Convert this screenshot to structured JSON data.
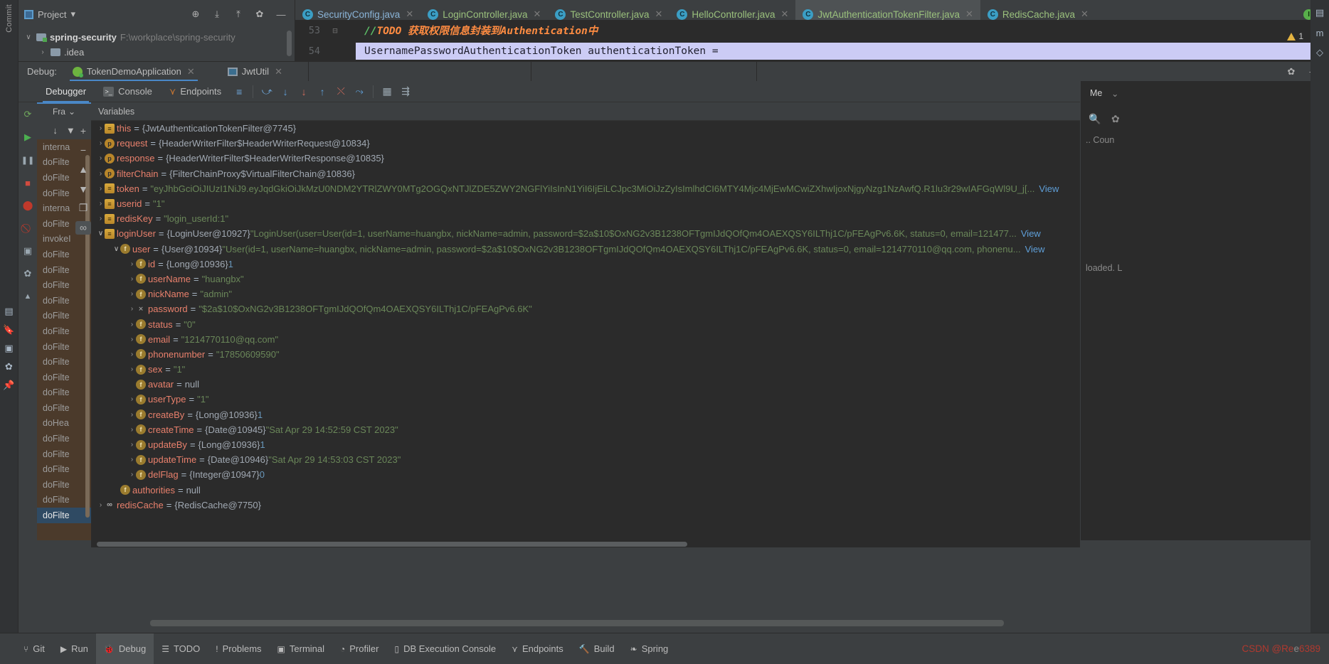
{
  "window": {
    "left_rail_label": "Commit",
    "left_rail_icons": [
      "git-icon",
      "structure-icon",
      "bookmarks-icon",
      "notifications-icon",
      "camera-icon",
      "settings-icon",
      "pin-icon"
    ]
  },
  "project_toolbar": {
    "title": "Project",
    "dropdown_caret": "▾",
    "icons": [
      {
        "name": "locate-icon",
        "glyph": "⊕"
      },
      {
        "name": "expand-all-icon",
        "glyph": "⤓"
      },
      {
        "name": "collapse-all-icon",
        "glyph": "⤒"
      },
      {
        "name": "gear-icon",
        "glyph": "✿"
      },
      {
        "name": "hide-icon",
        "glyph": "—"
      }
    ]
  },
  "project_tree": [
    {
      "twisty": "∨",
      "name": "spring-security",
      "path": "F:\\workplace\\spring-security",
      "bold": true,
      "modified": true
    },
    {
      "twisty": "›",
      "name": ".idea",
      "path": "",
      "bold": false,
      "modified": false
    }
  ],
  "editor_tabs": [
    {
      "label": "SecurityConfig.java",
      "icon": "class-icon",
      "active": false,
      "color": "#8ab4d8"
    },
    {
      "label": "LoginController.java",
      "icon": "class-icon",
      "active": false,
      "color": "#9ac07c"
    },
    {
      "label": "TestController.java",
      "icon": "class-icon",
      "active": false,
      "color": "#9ac07c"
    },
    {
      "label": "HelloController.java",
      "icon": "class-icon",
      "active": false,
      "color": "#9ac07c"
    },
    {
      "label": "JwtAuthenticationTokenFilter.java",
      "icon": "class-icon",
      "active": true,
      "color": "#9ac07c"
    },
    {
      "label": "RedisCache.java",
      "icon": "class-icon",
      "active": false,
      "color": "#9ac07c"
    }
  ],
  "editor": {
    "lines": [
      {
        "number": "53",
        "comment_slashes": "//",
        "comment_todo": "TODO",
        "comment_text": " 获取权限信息封装到Authentication中",
        "highlighted": false
      },
      {
        "number": "54",
        "code": "UsernamePasswordAuthenticationToken authenticationToken =",
        "highlighted": true
      }
    ],
    "warning_count": "1",
    "warning_chevron": "⌄"
  },
  "debug_header": {
    "label": "Debug:",
    "tabs": [
      {
        "label": "TokenDemoApplication",
        "icon": "spring-leaf-icon",
        "active": true,
        "closable": true
      },
      {
        "label": "JwtUtil",
        "icon": "run-config-icon",
        "active": false,
        "closable": true
      }
    ],
    "right_icons": [
      {
        "name": "settings-gear-icon",
        "glyph": "✿"
      },
      {
        "name": "hide-window-icon",
        "glyph": "—"
      }
    ]
  },
  "debugger_tabs": {
    "tabs": [
      {
        "label": "Debugger",
        "icon": "",
        "active": true
      },
      {
        "label": "Console",
        "icon": "console-icon",
        "active": false
      },
      {
        "label": "Endpoints",
        "icon": "endpoints-icon",
        "active": false
      }
    ],
    "toolbar_icons": [
      {
        "name": "layout-settings-icon",
        "glyph": "≡"
      },
      {
        "name": "step-over-icon",
        "glyph": "⤻"
      },
      {
        "name": "step-into-icon",
        "glyph": "↓"
      },
      {
        "name": "force-step-into-icon",
        "glyph": "↓"
      },
      {
        "name": "step-out-icon",
        "glyph": "↑"
      },
      {
        "name": "drop-frame-icon",
        "glyph": "⤬"
      },
      {
        "name": "run-to-cursor-icon",
        "glyph": "⤳"
      },
      {
        "name": "evaluate-expression-icon",
        "glyph": "▦"
      },
      {
        "name": "settings-filter-icon",
        "glyph": "⇶"
      }
    ]
  },
  "debug_rail_icons": [
    {
      "name": "rerun-icon",
      "glyph": "⟳"
    },
    {
      "name": "resume-program-icon",
      "glyph": "▶"
    },
    {
      "name": "pause-program-icon",
      "glyph": "❚❚"
    },
    {
      "name": "stop-icon",
      "glyph": "■"
    },
    {
      "name": "view-breakpoints-icon",
      "glyph": "⬤"
    },
    {
      "name": "mute-breakpoints-icon",
      "glyph": "⃠"
    },
    {
      "name": "screenshot-icon",
      "glyph": "▣"
    },
    {
      "name": "settings-icon",
      "glyph": "✿"
    },
    {
      "name": "pin-icon",
      "glyph": "📌"
    }
  ],
  "frames": {
    "header_label": "Fra",
    "header_caret": "⌄",
    "tools": [
      {
        "name": "show-frames-icon",
        "glyph": "↓"
      },
      {
        "name": "filter-frames-icon",
        "glyph": "▼"
      }
    ],
    "rows": [
      {
        "label": "doFilte",
        "selected": true
      },
      {
        "label": "doFilte",
        "selected": false
      },
      {
        "label": "doFilte",
        "selected": false
      },
      {
        "label": "doFilte",
        "selected": false
      },
      {
        "label": "doFilte",
        "selected": false
      },
      {
        "label": "doFilte",
        "selected": false
      },
      {
        "label": "doHea",
        "selected": false
      },
      {
        "label": "doFilte",
        "selected": false
      },
      {
        "label": "doFilte",
        "selected": false
      },
      {
        "label": "doFilte",
        "selected": false
      },
      {
        "label": "doFilte",
        "selected": false
      },
      {
        "label": "doFilte",
        "selected": false
      },
      {
        "label": "doFilte",
        "selected": false
      },
      {
        "label": "doFilte",
        "selected": false
      },
      {
        "label": "doFilte",
        "selected": false
      },
      {
        "label": "doFilte",
        "selected": false
      },
      {
        "label": "doFilte",
        "selected": false
      },
      {
        "label": "doFilte",
        "selected": false
      },
      {
        "label": "invokeI",
        "selected": false
      },
      {
        "label": "doFilte",
        "selected": false
      },
      {
        "label": "interna",
        "selected": false
      },
      {
        "label": "doFilte",
        "selected": false
      },
      {
        "label": "doFilte",
        "selected": false
      },
      {
        "label": "doFilte",
        "selected": false
      },
      {
        "label": "interna",
        "selected": false
      }
    ],
    "tail_label": "interna"
  },
  "vars_toolbar": [
    {
      "name": "add-watch-icon",
      "glyph": "+",
      "active": false
    },
    {
      "name": "remove-watch-icon",
      "glyph": "−",
      "active": false
    },
    {
      "name": "move-up-icon",
      "glyph": "▲",
      "active": false
    },
    {
      "name": "move-down-icon",
      "glyph": "▼",
      "active": false
    },
    {
      "name": "copy-value-icon",
      "glyph": "❐",
      "active": false
    },
    {
      "name": "inspect-icon",
      "glyph": "∞",
      "active": true
    }
  ],
  "variables": {
    "header": "Variables",
    "rows": [
      {
        "indent": 0,
        "twisty": "›",
        "icon": "local-var-icon",
        "icon_kind": "local",
        "icon_glyph": "≡",
        "name": "this",
        "value": "{JwtAuthenticationTokenFilter@7745}",
        "value_kind": "obj"
      },
      {
        "indent": 0,
        "twisty": "›",
        "icon": "parameter-icon",
        "icon_kind": "param",
        "icon_glyph": "p",
        "name": "request",
        "value": "{HeaderWriterFilter$HeaderWriterRequest@10834}",
        "value_kind": "obj"
      },
      {
        "indent": 0,
        "twisty": "›",
        "icon": "parameter-icon",
        "icon_kind": "param",
        "icon_glyph": "p",
        "name": "response",
        "value": "{HeaderWriterFilter$HeaderWriterResponse@10835}",
        "value_kind": "obj"
      },
      {
        "indent": 0,
        "twisty": "›",
        "icon": "parameter-icon",
        "icon_kind": "param",
        "icon_glyph": "p",
        "name": "filterChain",
        "value": "{FilterChainProxy$VirtualFilterChain@10836}",
        "value_kind": "obj"
      },
      {
        "indent": 0,
        "twisty": "›",
        "icon": "local-var-icon",
        "icon_kind": "local",
        "icon_glyph": "≡",
        "name": "token",
        "value": "\"eyJhbGciOiJIUzI1NiJ9.eyJqdGkiOiJkMzU0NDM2YTRlZWY0MTg2OGQxNTJlZDE5ZWY2NGFlYiIsInN1YiI6IjEiLCJpc3MiOiJzZyIsImlhdCI6MTY4Mjc4MjEwMCwiZXhwIjoxNjgyNzg1NzAwfQ.R1lu3r29wIAFGqWl9U_j[...",
        "value_kind": "str",
        "link": "View"
      },
      {
        "indent": 0,
        "twisty": "›",
        "icon": "local-var-icon",
        "icon_kind": "local",
        "icon_glyph": "≡",
        "name": "userid",
        "value": "\"1\"",
        "value_kind": "str"
      },
      {
        "indent": 0,
        "twisty": "›",
        "icon": "local-var-icon",
        "icon_kind": "local",
        "icon_glyph": "≡",
        "name": "redisKey",
        "value": "\"login_userId:1\"",
        "value_kind": "str"
      },
      {
        "indent": 0,
        "twisty": "∨",
        "icon": "local-var-icon",
        "icon_kind": "local",
        "icon_glyph": "≡",
        "name": "loginUser",
        "value_obj": "{LoginUser@10927}",
        "value": " \"LoginUser(user=User(id=1, userName=huangbx, nickName=admin, password=$2a$10$OxNG2v3B1238OFTgmIJdQOfQm4OAEXQSY6ILThj1C/pFEAgPv6.6K, status=0, email=121477...",
        "value_kind": "mixed",
        "link": "View"
      },
      {
        "indent": 1,
        "twisty": "∨",
        "icon": "field-icon",
        "icon_kind": "field",
        "icon_glyph": "f",
        "name": "user",
        "value_obj": "{User@10934}",
        "value": " \"User(id=1, userName=huangbx, nickName=admin, password=$2a$10$OxNG2v3B1238OFTgmIJdQOfQm4OAEXQSY6ILThj1C/pFEAgPv6.6K, status=0, email=1214770110@qq.com, phonenu...",
        "value_kind": "mixed",
        "link": "View"
      },
      {
        "indent": 2,
        "twisty": "›",
        "icon": "field-icon",
        "icon_kind": "field",
        "icon_glyph": "f",
        "name": "id",
        "value_obj": "{Long@10936}",
        "value": " 1",
        "value_kind": "mixed_num"
      },
      {
        "indent": 2,
        "twisty": "›",
        "icon": "field-icon",
        "icon_kind": "field",
        "icon_glyph": "f",
        "name": "userName",
        "value": "\"huangbx\"",
        "value_kind": "str"
      },
      {
        "indent": 2,
        "twisty": "›",
        "icon": "field-icon",
        "icon_kind": "field",
        "icon_glyph": "f",
        "name": "nickName",
        "value": "\"admin\"",
        "value_kind": "str"
      },
      {
        "indent": 2,
        "twisty": "›",
        "icon": "masked-field-icon",
        "icon_kind": "bin",
        "icon_glyph": "⨯",
        "name": "password",
        "value": "\"$2a$10$OxNG2v3B1238OFTgmIJdQOfQm4OAEXQSY6ILThj1C/pFEAgPv6.6K\"",
        "value_kind": "str"
      },
      {
        "indent": 2,
        "twisty": "›",
        "icon": "field-icon",
        "icon_kind": "field",
        "icon_glyph": "f",
        "name": "status",
        "value": "\"0\"",
        "value_kind": "str"
      },
      {
        "indent": 2,
        "twisty": "›",
        "icon": "field-icon",
        "icon_kind": "field",
        "icon_glyph": "f",
        "name": "email",
        "value": "\"1214770110@qq.com\"",
        "value_kind": "str"
      },
      {
        "indent": 2,
        "twisty": "›",
        "icon": "field-icon",
        "icon_kind": "field",
        "icon_glyph": "f",
        "name": "phonenumber",
        "value": "\"17850609590\"",
        "value_kind": "str"
      },
      {
        "indent": 2,
        "twisty": "›",
        "icon": "field-icon",
        "icon_kind": "field",
        "icon_glyph": "f",
        "name": "sex",
        "value": "\"1\"",
        "value_kind": "str"
      },
      {
        "indent": 2,
        "twisty": "",
        "icon": "field-icon",
        "icon_kind": "field",
        "icon_glyph": "f",
        "name": "avatar",
        "value": "null",
        "value_kind": "null"
      },
      {
        "indent": 2,
        "twisty": "›",
        "icon": "field-icon",
        "icon_kind": "field",
        "icon_glyph": "f",
        "name": "userType",
        "value": "\"1\"",
        "value_kind": "str"
      },
      {
        "indent": 2,
        "twisty": "›",
        "icon": "field-icon",
        "icon_kind": "field",
        "icon_glyph": "f",
        "name": "createBy",
        "value_obj": "{Long@10936}",
        "value": " 1",
        "value_kind": "mixed_num"
      },
      {
        "indent": 2,
        "twisty": "›",
        "icon": "field-icon",
        "icon_kind": "field",
        "icon_glyph": "f",
        "name": "createTime",
        "value_obj": "{Date@10945}",
        "value": " \"Sat Apr 29 14:52:59 CST 2023\"",
        "value_kind": "mixed"
      },
      {
        "indent": 2,
        "twisty": "›",
        "icon": "field-icon",
        "icon_kind": "field",
        "icon_glyph": "f",
        "name": "updateBy",
        "value_obj": "{Long@10936}",
        "value": " 1",
        "value_kind": "mixed_num"
      },
      {
        "indent": 2,
        "twisty": "›",
        "icon": "field-icon",
        "icon_kind": "field",
        "icon_glyph": "f",
        "name": "updateTime",
        "value_obj": "{Date@10946}",
        "value": " \"Sat Apr 29 14:53:03 CST 2023\"",
        "value_kind": "mixed"
      },
      {
        "indent": 2,
        "twisty": "›",
        "icon": "field-icon",
        "icon_kind": "field",
        "icon_glyph": "f",
        "name": "delFlag",
        "value_obj": "{Integer@10947}",
        "value": " 0",
        "value_kind": "mixed_num"
      },
      {
        "indent": 1,
        "twisty": "",
        "icon": "field-icon",
        "icon_kind": "field",
        "icon_glyph": "f",
        "name": "authorities",
        "value": "null",
        "value_kind": "null"
      },
      {
        "indent": 0,
        "twisty": "›",
        "icon": "watch-icon",
        "icon_kind": "watch",
        "icon_glyph": "∞",
        "name": "redisCache",
        "value": "{RedisCache@7750}",
        "value_kind": "obj"
      }
    ]
  },
  "right_panel": {
    "header_label": "Me",
    "header_caret": "⌄",
    "search_icon": "search-icon",
    "settings_icon": "gear-icon",
    "line1": ".. Coun",
    "line2": "loaded. L"
  },
  "right_rail_icons": [
    {
      "name": "database-icon",
      "glyph": "▤"
    },
    {
      "name": "maven-icon",
      "glyph": "m"
    },
    {
      "name": "gradle-icon",
      "glyph": "◇"
    },
    {
      "name": "notifications-icon",
      "glyph": "🔔"
    }
  ],
  "status_bar": {
    "items": [
      {
        "label": "Git",
        "icon": "git-branch-icon",
        "glyph": "⑂",
        "active": false
      },
      {
        "label": "Run",
        "icon": "run-icon",
        "glyph": "▶",
        "active": false
      },
      {
        "label": "Debug",
        "icon": "debug-bug-icon",
        "glyph": "🐞",
        "active": true
      },
      {
        "label": "TODO",
        "icon": "todo-list-icon",
        "glyph": "☰",
        "active": false
      },
      {
        "label": "Problems",
        "icon": "problems-icon",
        "glyph": "!",
        "active": false
      },
      {
        "label": "Terminal",
        "icon": "terminal-icon",
        "glyph": "▣",
        "active": false
      },
      {
        "label": "Profiler",
        "icon": "profiler-icon",
        "glyph": "◔",
        "active": false
      },
      {
        "label": "DB Execution Console",
        "icon": "db-console-icon",
        "glyph": "▯",
        "active": false
      },
      {
        "label": "Endpoints",
        "icon": "endpoints-icon",
        "glyph": "⋎",
        "active": false
      },
      {
        "label": "Build",
        "icon": "build-hammer-icon",
        "glyph": "🔨",
        "active": false
      },
      {
        "label": "Spring",
        "icon": "spring-leaf-icon",
        "glyph": "❧",
        "active": false
      }
    ],
    "watermark_prefix": "CSDN @Re",
    "watermark_mid": "e",
    "watermark_suffix": "6389"
  }
}
